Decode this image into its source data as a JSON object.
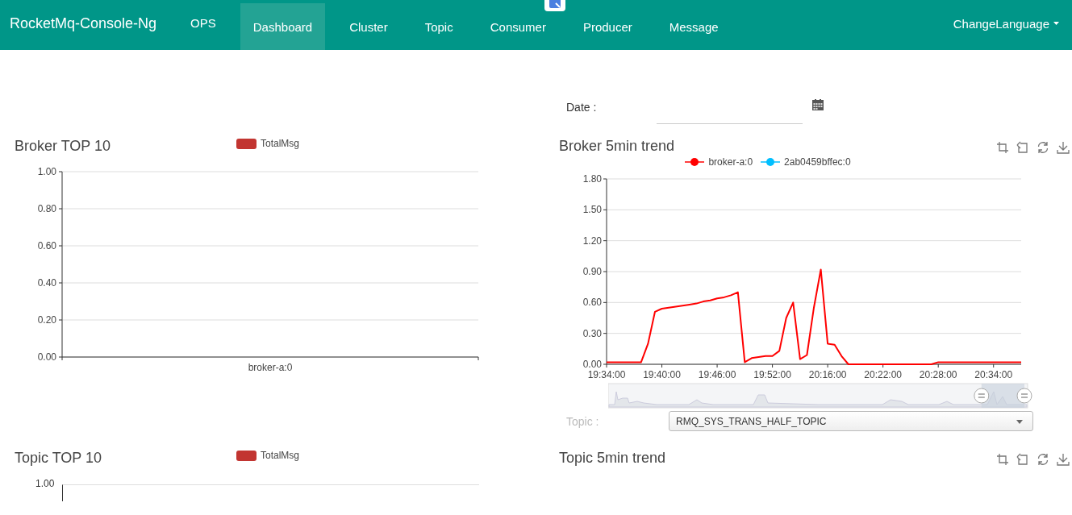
{
  "navbar": {
    "brand": "RocketMq-Console-Ng",
    "items": [
      {
        "label": "OPS",
        "selected": false
      },
      {
        "label": "Dashboard",
        "selected": true
      },
      {
        "label": "Cluster",
        "selected": false
      },
      {
        "label": "Topic",
        "selected": false
      },
      {
        "label": "Consumer",
        "selected": false
      },
      {
        "label": "Producer",
        "selected": false
      },
      {
        "label": "Message",
        "selected": false
      }
    ],
    "language_menu": "ChangeLanguage"
  },
  "date_filter": {
    "label": "Date :"
  },
  "broker_top10": {
    "title": "Broker TOP 10",
    "chart_data": {
      "type": "bar",
      "categories": [
        "broker-a:0"
      ],
      "grid": true,
      "series": [
        {
          "name": "TotalMsg",
          "color": "#c23531",
          "values": [
            0
          ]
        }
      ],
      "ylim": [
        0,
        1
      ],
      "yticks": [
        {
          "value": 0,
          "label": "0.00"
        },
        {
          "value": 0.2,
          "label": "0.20"
        },
        {
          "value": 0.4,
          "label": "0.40"
        },
        {
          "value": 0.6,
          "label": "0.60"
        },
        {
          "value": 0.8,
          "label": "0.80"
        },
        {
          "value": 1,
          "label": "1.00"
        }
      ]
    }
  },
  "broker_trend": {
    "title": "Broker 5min trend",
    "chart_data": {
      "type": "line",
      "grid": true,
      "categories": [
        "19:34:00",
        null,
        null,
        null,
        null,
        null,
        null,
        null,
        "19:40:00",
        null,
        null,
        null,
        null,
        null,
        null,
        null,
        "19:46:00",
        null,
        null,
        null,
        null,
        null,
        null,
        null,
        "19:52:00",
        null,
        null,
        null,
        null,
        null,
        null,
        null,
        "20:16:00",
        null,
        null,
        null,
        null,
        null,
        null,
        null,
        "20:22:00",
        null,
        null,
        null,
        null,
        null,
        null,
        null,
        "20:28:00",
        null,
        null,
        null,
        null,
        null,
        null,
        null,
        "20:34:00",
        null,
        null,
        null,
        null
      ],
      "series": [
        {
          "name": "broker-a:0",
          "color": "#ff0000",
          "values": [
            0.02,
            0.02,
            0.02,
            0.02,
            0.02,
            0.02,
            0.2,
            0.51,
            0.54,
            0.55,
            0.56,
            0.57,
            0.58,
            0.59,
            0.61,
            0.62,
            0.64,
            0.65,
            0.67,
            0.7,
            0.02,
            0.06,
            0.07,
            0.08,
            0.08,
            0.13,
            0.45,
            0.6,
            0.05,
            0.09,
            0.55,
            0.92,
            0.2,
            0.19,
            0.08,
            0,
            0,
            0,
            0,
            0,
            0,
            0,
            0,
            0,
            0,
            0,
            0,
            0,
            0.02,
            0.02,
            0.02,
            0.02,
            0.02,
            0.02,
            0.02,
            0.02,
            0.02,
            0.02,
            0.02,
            0.02,
            0.02
          ]
        },
        {
          "name": "2ab0459bffec:0",
          "color": "#00bfff",
          "values": [
            null,
            null,
            null,
            null,
            null,
            null,
            null,
            null,
            null,
            null,
            null,
            null,
            null,
            null,
            null,
            null,
            null,
            null,
            null,
            null,
            null,
            null,
            null,
            null,
            null,
            null,
            null,
            null,
            null,
            null,
            null,
            null,
            null,
            null,
            null,
            null,
            null,
            null,
            null,
            null,
            null,
            null,
            null,
            null,
            null,
            null,
            null,
            null,
            null,
            null,
            null,
            null,
            null,
            null,
            null,
            null,
            null,
            null,
            null,
            null,
            null
          ]
        }
      ],
      "ylim": [
        0,
        1.8
      ],
      "yticks": [
        {
          "value": 0,
          "label": "0.00"
        },
        {
          "value": 0.3,
          "label": "0.30"
        },
        {
          "value": 0.6,
          "label": "0.60"
        },
        {
          "value": 0.9,
          "label": "0.90"
        },
        {
          "value": 1.2,
          "label": "1.20"
        },
        {
          "value": 1.5,
          "label": "1.50"
        },
        {
          "value": 1.8,
          "label": "1.80"
        }
      ]
    },
    "data_zoom": {
      "level": 0.89
    }
  },
  "topic_filter": {
    "label": "Topic :",
    "value": "RMQ_SYS_TRANS_HALF_TOPIC"
  },
  "topic_top10": {
    "title": "Topic TOP 10",
    "legend": "TotalMsg",
    "ytick_label": "1.00"
  },
  "topic_trend": {
    "title": "Topic 5min trend"
  }
}
